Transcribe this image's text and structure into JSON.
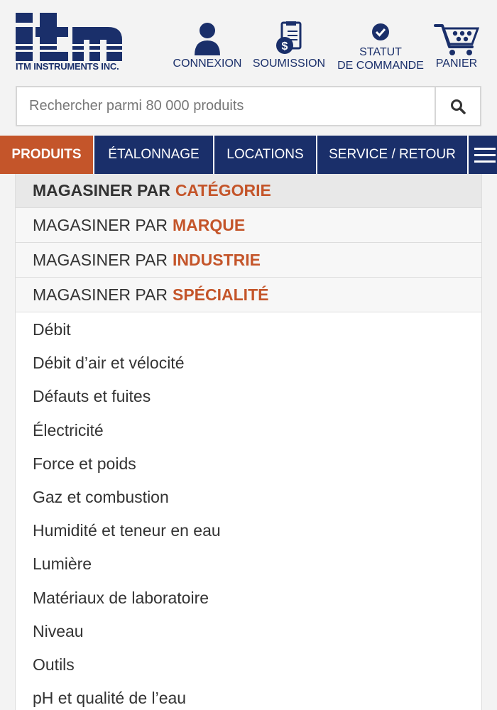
{
  "header": {
    "logo": {
      "mark_text": "itm",
      "subtitle": "ITM INSTRUMENTS INC."
    },
    "links": [
      {
        "label": "CONNEXION",
        "icon": "user-icon"
      },
      {
        "label": "SOUMISSION",
        "icon": "quote-icon"
      },
      {
        "label_line1": "STATUT",
        "label_line2": "DE COMMANDE",
        "icon": "check-circle-icon"
      },
      {
        "label": "PANIER",
        "icon": "cart-icon"
      }
    ]
  },
  "search": {
    "placeholder": "Rechercher parmi 80 000 produits",
    "value": "",
    "icon": "search-icon"
  },
  "nav": {
    "items": [
      {
        "label": "PRODUITS",
        "active": true
      },
      {
        "label": "ÉTALONNAGE"
      },
      {
        "label": "LOCATIONS"
      },
      {
        "label": "SERVICE / RETOUR"
      }
    ],
    "menu_icon": "hamburger-menu-icon"
  },
  "shop_by": [
    {
      "prefix": "MAGASINER PAR",
      "highlight": "CATÉGORIE",
      "active": true
    },
    {
      "prefix": "MAGASINER PAR",
      "highlight": "MARQUE"
    },
    {
      "prefix": "MAGASINER PAR",
      "highlight": "INDUSTRIE"
    },
    {
      "prefix": "MAGASINER PAR",
      "highlight": "SPÉCIALITÉ"
    }
  ],
  "categories": [
    "Débit",
    "Débit d’air et vélocité",
    "Défauts et fuites",
    "Électricité",
    "Force et poids",
    "Gaz et combustion",
    "Humidité et teneur en eau",
    "Lumière",
    "Matériaux de laboratoire",
    "Niveau",
    "Outils",
    "pH et qualité de l’eau"
  ],
  "colors": {
    "brand_blue": "#1a2f6a",
    "accent_orange": "#c4552a",
    "background": "#f3f3f3"
  }
}
